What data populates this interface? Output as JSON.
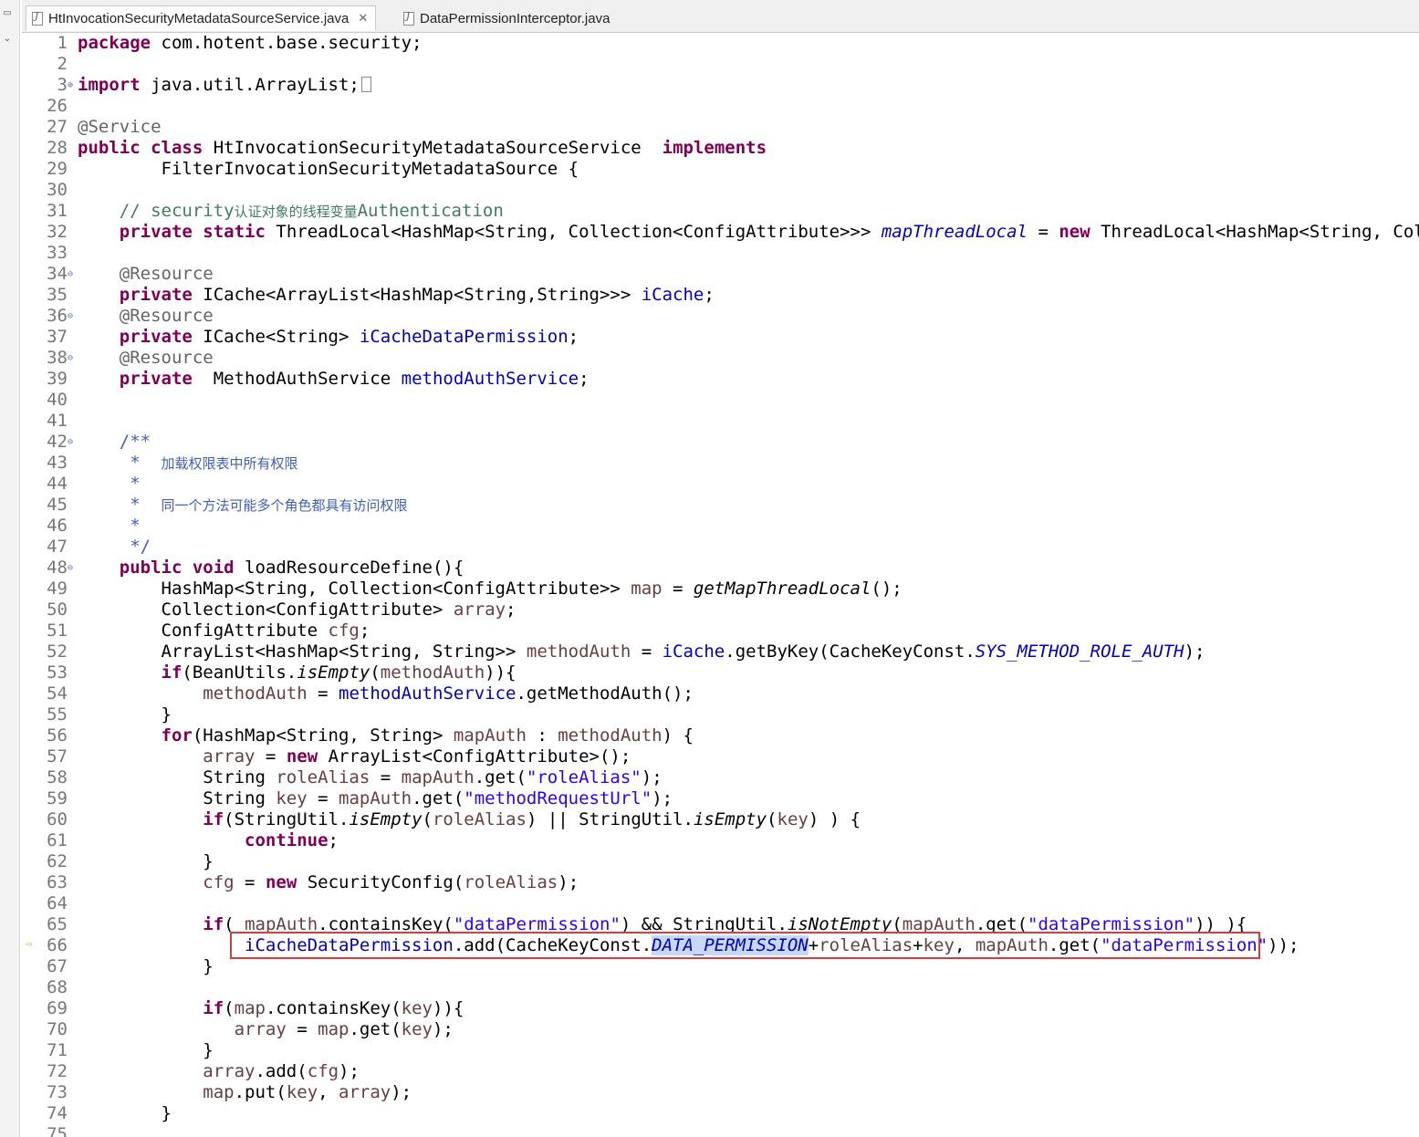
{
  "tabs": [
    {
      "label": "HtInvocationSecurityMetadataSourceService.java",
      "active": true
    },
    {
      "label": "DataPermissionInterceptor.java",
      "active": false
    }
  ],
  "code_lines": [
    {
      "n": "1",
      "fold": ""
    },
    {
      "n": "2",
      "fold": ""
    },
    {
      "n": "3",
      "fold": "⊕"
    },
    {
      "n": "26",
      "fold": ""
    },
    {
      "n": "27",
      "fold": ""
    },
    {
      "n": "28",
      "fold": ""
    },
    {
      "n": "29",
      "fold": ""
    },
    {
      "n": "30",
      "fold": ""
    },
    {
      "n": "31",
      "fold": ""
    },
    {
      "n": "32",
      "fold": ""
    },
    {
      "n": "33",
      "fold": ""
    },
    {
      "n": "34",
      "fold": "⊖"
    },
    {
      "n": "35",
      "fold": ""
    },
    {
      "n": "36",
      "fold": "⊖"
    },
    {
      "n": "37",
      "fold": ""
    },
    {
      "n": "38",
      "fold": "⊖"
    },
    {
      "n": "39",
      "fold": ""
    },
    {
      "n": "40",
      "fold": ""
    },
    {
      "n": "41",
      "fold": ""
    },
    {
      "n": "42",
      "fold": "⊖"
    },
    {
      "n": "43",
      "fold": ""
    },
    {
      "n": "44",
      "fold": ""
    },
    {
      "n": "45",
      "fold": ""
    },
    {
      "n": "46",
      "fold": ""
    },
    {
      "n": "47",
      "fold": ""
    },
    {
      "n": "48",
      "fold": "⊖"
    },
    {
      "n": "49",
      "fold": ""
    },
    {
      "n": "50",
      "fold": ""
    },
    {
      "n": "51",
      "fold": ""
    },
    {
      "n": "52",
      "fold": ""
    },
    {
      "n": "53",
      "fold": ""
    },
    {
      "n": "54",
      "fold": ""
    },
    {
      "n": "55",
      "fold": ""
    },
    {
      "n": "56",
      "fold": ""
    },
    {
      "n": "57",
      "fold": ""
    },
    {
      "n": "58",
      "fold": ""
    },
    {
      "n": "59",
      "fold": ""
    },
    {
      "n": "60",
      "fold": ""
    },
    {
      "n": "61",
      "fold": ""
    },
    {
      "n": "62",
      "fold": ""
    },
    {
      "n": "63",
      "fold": ""
    },
    {
      "n": "64",
      "fold": ""
    },
    {
      "n": "65",
      "fold": ""
    },
    {
      "n": "66",
      "fold": ""
    },
    {
      "n": "67",
      "fold": ""
    },
    {
      "n": "68",
      "fold": ""
    },
    {
      "n": "69",
      "fold": ""
    },
    {
      "n": "70",
      "fold": ""
    },
    {
      "n": "71",
      "fold": ""
    },
    {
      "n": "72",
      "fold": ""
    },
    {
      "n": "73",
      "fold": ""
    },
    {
      "n": "74",
      "fold": ""
    },
    {
      "n": "75",
      "fold": ""
    }
  ],
  "code": {
    "l1": {
      "k": "package",
      "t": " com.hotent.base.security;"
    },
    "l3": {
      "k": "import",
      "t": " java.util.ArrayList;"
    },
    "l27": {
      "a": "@Service"
    },
    "l28": {
      "k1": "public",
      "k2": "class",
      "t": " HtInvocationSecurityMetadataSourceService  ",
      "k3": "implements"
    },
    "l29": {
      "t": "        FilterInvocationSecurityMetadataSource {"
    },
    "l31": {
      "c1": "    // security",
      "c2": "认证对象的线程变量",
      "c3": "Authentication"
    },
    "l32": {
      "k1": "private",
      "k2": "static",
      "t1": " ThreadLocal<HashMap<String, Collection<ConfigAttribute>>> ",
      "f": "mapThreadLocal",
      "t2": " = ",
      "k3": "new",
      "t3": " ThreadLocal<HashMap<String, Collection<ConfigAttribute>>>();"
    },
    "l34": {
      "a": "    @Resource"
    },
    "l35": {
      "k": "private",
      "t": " ICache<ArrayList<HashMap<String,String>>> ",
      "f": "iCache",
      "e": ";"
    },
    "l36": {
      "a": "    @Resource"
    },
    "l37": {
      "k": "private",
      "t": " ICache<String> ",
      "f": "iCacheDataPermission",
      "e": ";"
    },
    "l38": {
      "a": "    @Resource"
    },
    "l39": {
      "k": "private",
      "t": "  MethodAuthService ",
      "f": "methodAuthService",
      "e": ";"
    },
    "l42": {
      "d": "    /**"
    },
    "l43": {
      "d1": "     *  ",
      "d2": "加载权限表中所有权限"
    },
    "l44": {
      "d": "     *"
    },
    "l45": {
      "d1": "     *  ",
      "d2": "同一个方法可能多个角色都具有访问权限"
    },
    "l46": {
      "d": "     *"
    },
    "l47": {
      "d": "     */"
    },
    "l48": {
      "k1": "public",
      "k2": "void",
      "t": " loadResourceDefine(){"
    },
    "l49": {
      "t1": "        HashMap<String, Collection<ConfigAttribute>> ",
      "v": "map",
      "t2": " = ",
      "m": "getMapThreadLocal",
      "t3": "();"
    },
    "l50": {
      "t1": "        Collection<ConfigAttribute> ",
      "v": "array",
      "t2": ";"
    },
    "l51": {
      "t1": "        ConfigAttribute ",
      "v": "cfg",
      "t2": ";"
    },
    "l52": {
      "t1": "        ArrayList<HashMap<String, String>> ",
      "v": "methodAuth",
      "t2": " = ",
      "f": "iCache",
      "t3": ".getByKey(CacheKeyConst.",
      "s": "SYS_METHOD_ROLE_AUTH",
      "t4": ");"
    },
    "l53": {
      "k": "if",
      "t1": "(BeanUtils.",
      "m": "isEmpty",
      "t2": "(",
      "v": "methodAuth",
      "t3": ")){"
    },
    "l54": {
      "v": "methodAuth",
      "t1": " = ",
      "f": "methodAuthService",
      "t2": ".getMethodAuth();"
    },
    "l55": {
      "t": "        }"
    },
    "l56": {
      "k": "for",
      "t1": "(HashMap<String, String> ",
      "v1": "mapAuth",
      "t2": " : ",
      "v2": "methodAuth",
      "t3": ") {"
    },
    "l57": {
      "v": "array",
      "t1": " = ",
      "k": "new",
      "t2": " ArrayList<ConfigAttribute>();"
    },
    "l58": {
      "t1": "            String ",
      "v": "roleAlias",
      "t2": " = ",
      "v2": "mapAuth",
      "t3": ".get(",
      "s": "\"roleAlias\"",
      "t4": ");"
    },
    "l59": {
      "t1": "            String ",
      "v": "key",
      "t2": " = ",
      "v2": "mapAuth",
      "t3": ".get(",
      "s": "\"methodRequestUrl\"",
      "t4": ");"
    },
    "l60": {
      "k": "if",
      "t1": "(StringUtil.",
      "m1": "isEmpty",
      "t2": "(",
      "v1": "roleAlias",
      "t3": ") || StringUtil.",
      "m2": "isEmpty",
      "t4": "(",
      "v2": "key",
      "t5": ") ) {"
    },
    "l61": {
      "k": "continue",
      "t": ";"
    },
    "l62": {
      "t": "            }"
    },
    "l63": {
      "v": "cfg",
      "t1": " = ",
      "k": "new",
      "t2": " SecurityConfig(",
      "v2": "roleAlias",
      "t3": ");"
    },
    "l65": {
      "k": "if",
      "t1": "( ",
      "v1": "mapAuth",
      "t2": ".containsKey(",
      "s1": "\"dataPermission\"",
      "t3": ") && StringUtil.",
      "m": "isNotEmpty",
      "t4": "(",
      "v2": "mapAuth",
      "t5": ".get(",
      "s2": "\"dataPermission\"",
      "t6": ")) ){"
    },
    "l66": {
      "f": "iCacheDataPermission",
      "t1": ".add(CacheKeyConst.",
      "s": "DATA_PERMISSION",
      "t2": "+",
      "v1": "roleAlias",
      "t3": "+",
      "v2": "key",
      "t4": ", ",
      "v3": "mapAuth",
      "t5": ".get(",
      "str": "\"dataPermission\"",
      "t6": "));"
    },
    "l67": {
      "t": "            }"
    },
    "l69": {
      "k": "if",
      "t1": "(",
      "v1": "map",
      "t2": ".containsKey(",
      "v2": "key",
      "t3": ")){"
    },
    "l70": {
      "v1": "array",
      "t1": " = ",
      "v2": "map",
      "t2": ".get(",
      "v3": "key",
      "t3": ");"
    },
    "l71": {
      "t": "            }"
    },
    "l72": {
      "v1": "array",
      "t1": ".add(",
      "v2": "cfg",
      "t2": ");"
    },
    "l73": {
      "v1": "map",
      "t1": ".put(",
      "v2": "key",
      "t2": ", ",
      "v3": "array",
      "t3": ");"
    },
    "l74": {
      "t": "        }"
    }
  }
}
